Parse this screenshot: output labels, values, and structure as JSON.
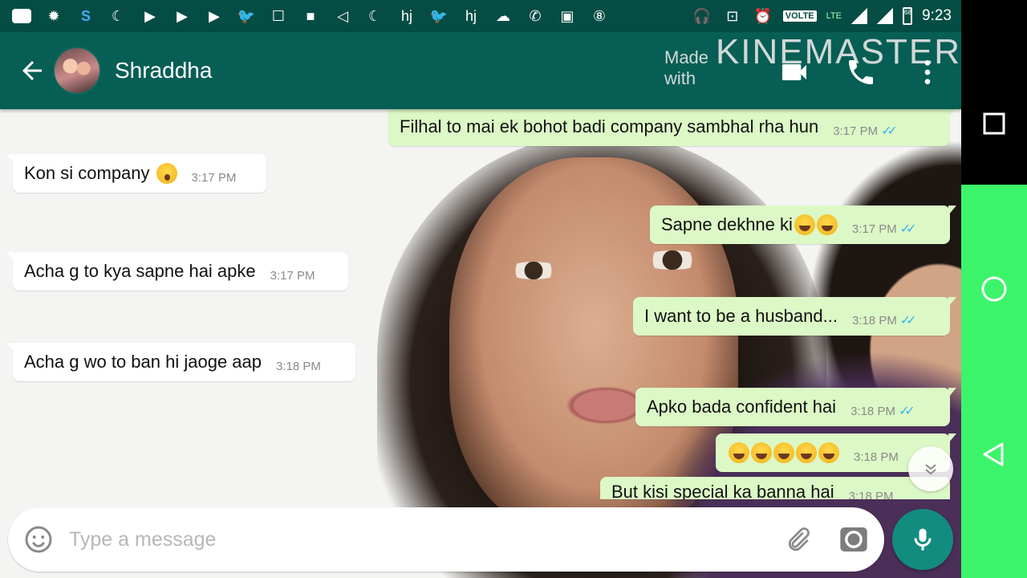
{
  "status_bar": {
    "time": "9:23",
    "volte": "VOLTE",
    "network": "LTE",
    "battery": "68",
    "notification_icons": [
      "chat-icon",
      "settings-icon",
      "s-app-icon",
      "uc-browser-icon",
      "youtube-icon",
      "youtube-icon",
      "youtube-icon",
      "twitter-icon",
      "outlook-icon",
      "video-icon",
      "send-icon",
      "uc-browser-icon",
      "hj-icon",
      "twitter-icon",
      "hj-icon",
      "cloud-icon",
      "whatsapp-icon",
      "image-icon",
      "8-ball-icon",
      "headphones-icon",
      "cast-icon",
      "alarm-icon"
    ]
  },
  "header": {
    "contact_name": "Shraddha",
    "watermark_made_with": "Made with",
    "watermark_brand": "KINEMASTER"
  },
  "messages": [
    {
      "dir": "out",
      "text": "Filhal to mai ek bohot badi company sambhal rha hun",
      "time": "3:17 PM"
    },
    {
      "dir": "in",
      "text": "Kon si company",
      "emoji": "wow",
      "time": "3:17 PM"
    },
    {
      "dir": "out",
      "text": "Sapne dekhne ki",
      "emoji": "joy-x2",
      "time": "3:17 PM"
    },
    {
      "dir": "in",
      "text": "Acha g to kya sapne hai apke",
      "time": "3:17 PM"
    },
    {
      "dir": "out",
      "text": "I want to be a husband...",
      "time": "3:18 PM"
    },
    {
      "dir": "in",
      "text": "Acha g wo to ban hi jaoge aap",
      "time": "3:18 PM"
    },
    {
      "dir": "out",
      "text": "Apko bada confident hai",
      "time": "3:18 PM"
    },
    {
      "dir": "out",
      "text": "",
      "emoji": "joy-x5",
      "time": "3:18 PM"
    },
    {
      "dir": "out",
      "text": "But kisi special ka banna hai",
      "time": "3:18 PM"
    }
  ],
  "input": {
    "placeholder": "Type a message"
  },
  "colors": {
    "status_bar": "#054d44",
    "header": "#075e54",
    "outgoing_bubble": "#dcf8c6",
    "incoming_bubble": "#ffffff",
    "read_ticks": "#34b7f1",
    "mic_button": "#128c7e",
    "nav_overlay": "#3cf46a"
  }
}
